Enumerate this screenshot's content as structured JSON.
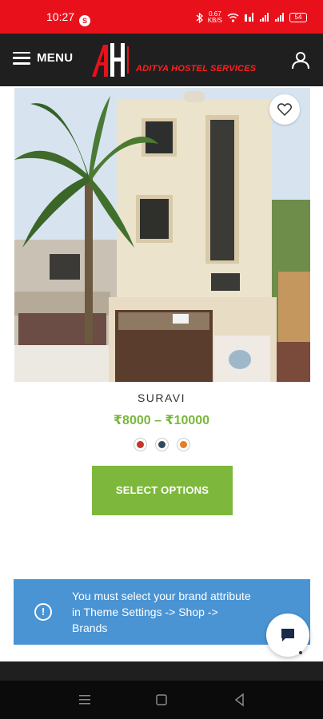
{
  "status_bar": {
    "time": "10:27",
    "notification_badge": "S",
    "network_speed_value": "0.67",
    "network_speed_unit": "KB/S",
    "battery": "54"
  },
  "header": {
    "menu_label": "MENU",
    "brand_name": "ADITYA HOSTEL SERVICES",
    "logo_icon": "ah-logo-icon",
    "user_icon": "user-icon"
  },
  "product": {
    "name": "SURAVI",
    "price": "₹8000 – ₹10000",
    "brand_badges": [
      "brand-logo-1",
      "brand-logo-2",
      "brand-logo-3"
    ],
    "select_label": "SELECT OPTIONS",
    "wishlist_icon": "heart-icon"
  },
  "notice": {
    "text": "You must select your brand attribute in Theme Settings -> Shop -> Brands",
    "icon": "info-icon"
  },
  "chat": {
    "icon": "chat-icon"
  },
  "nav_bar": {
    "buttons": [
      "recents-icon",
      "home-icon",
      "back-icon"
    ]
  },
  "colors": {
    "status_bar": "#e8111b",
    "header": "#1f1f1f",
    "brand_text": "#ff2020",
    "price": "#79b73b",
    "select_button": "#7db83c",
    "notice": "#4a94d4"
  }
}
